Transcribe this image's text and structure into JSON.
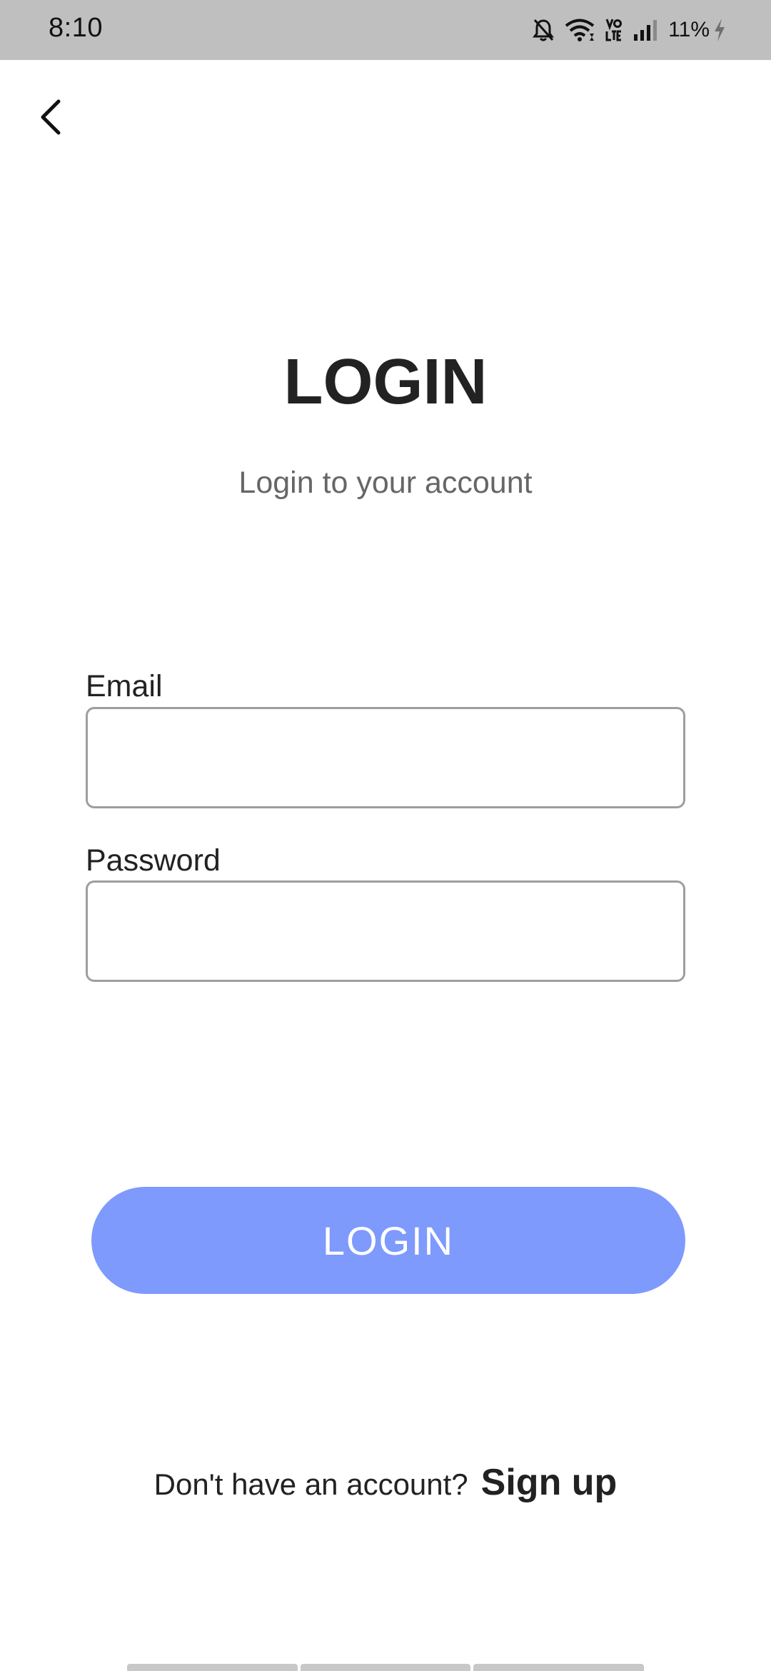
{
  "status_bar": {
    "time": "8:10",
    "battery": "11%",
    "icons": [
      "bell-off-icon",
      "wifi-icon",
      "volte-icon",
      "signal-icon",
      "charging-icon"
    ]
  },
  "header": {
    "back_icon": "chevron-left-icon"
  },
  "main": {
    "title": "LOGIN",
    "subtitle": "Login to your account",
    "email_label": "Email",
    "email_value": "",
    "password_label": "Password",
    "password_value": "",
    "login_button": "LOGIN"
  },
  "footer": {
    "prompt": "Don't have an account?",
    "signup_link": "Sign up"
  },
  "colors": {
    "status_bar": "#bfbfbf",
    "button": "#7e9afc",
    "input_border": "#9e9e9e",
    "subtitle": "#666666",
    "text": "#222222"
  }
}
